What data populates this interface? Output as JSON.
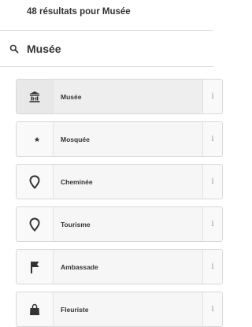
{
  "header": {
    "results_text": "48 résultats pour Musée"
  },
  "search": {
    "query": "Musée",
    "icon": "search-icon"
  },
  "presets": [
    {
      "label": "Musée",
      "icon": "museum-icon",
      "info": "i",
      "selected": true
    },
    {
      "label": "Mosquée",
      "icon": "crescent-star-icon",
      "info": "i",
      "selected": false
    },
    {
      "label": "Cheminée",
      "icon": "map-pin-icon",
      "info": "i",
      "selected": false
    },
    {
      "label": "Tourisme",
      "icon": "map-pin-icon",
      "info": "i",
      "selected": false
    },
    {
      "label": "Ambassade",
      "icon": "flag-icon",
      "info": "i",
      "selected": false
    },
    {
      "label": "Fleuriste",
      "icon": "shopping-bag-icon",
      "info": "i",
      "selected": false
    }
  ]
}
